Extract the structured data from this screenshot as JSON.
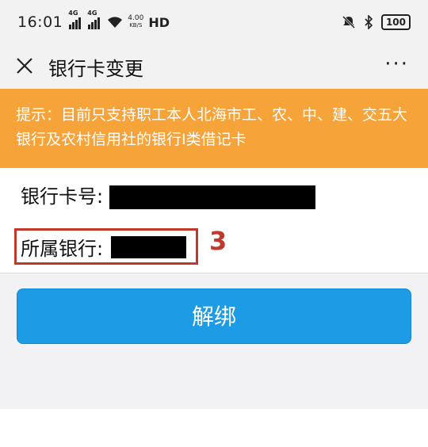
{
  "status_bar": {
    "time": "16:01",
    "network": "4G",
    "speed_value": "4.00",
    "speed_unit": "KB/S",
    "hd": "HD",
    "battery": "100"
  },
  "nav": {
    "title": "银行卡变更",
    "more": "···"
  },
  "tip": {
    "text": "提示：目前只支持职工本人北海市工、农、中、建、交五大银行及农村信用社的银行I类借记卡"
  },
  "form": {
    "card_number_label": "银行卡号:",
    "bank_label": "所属银行:"
  },
  "annotation": {
    "number": "3"
  },
  "actions": {
    "unbind_label": "解绑"
  },
  "colors": {
    "tip_bg": "#f6a33a",
    "button_bg": "#1e9be5",
    "annotation": "#c0392b"
  }
}
